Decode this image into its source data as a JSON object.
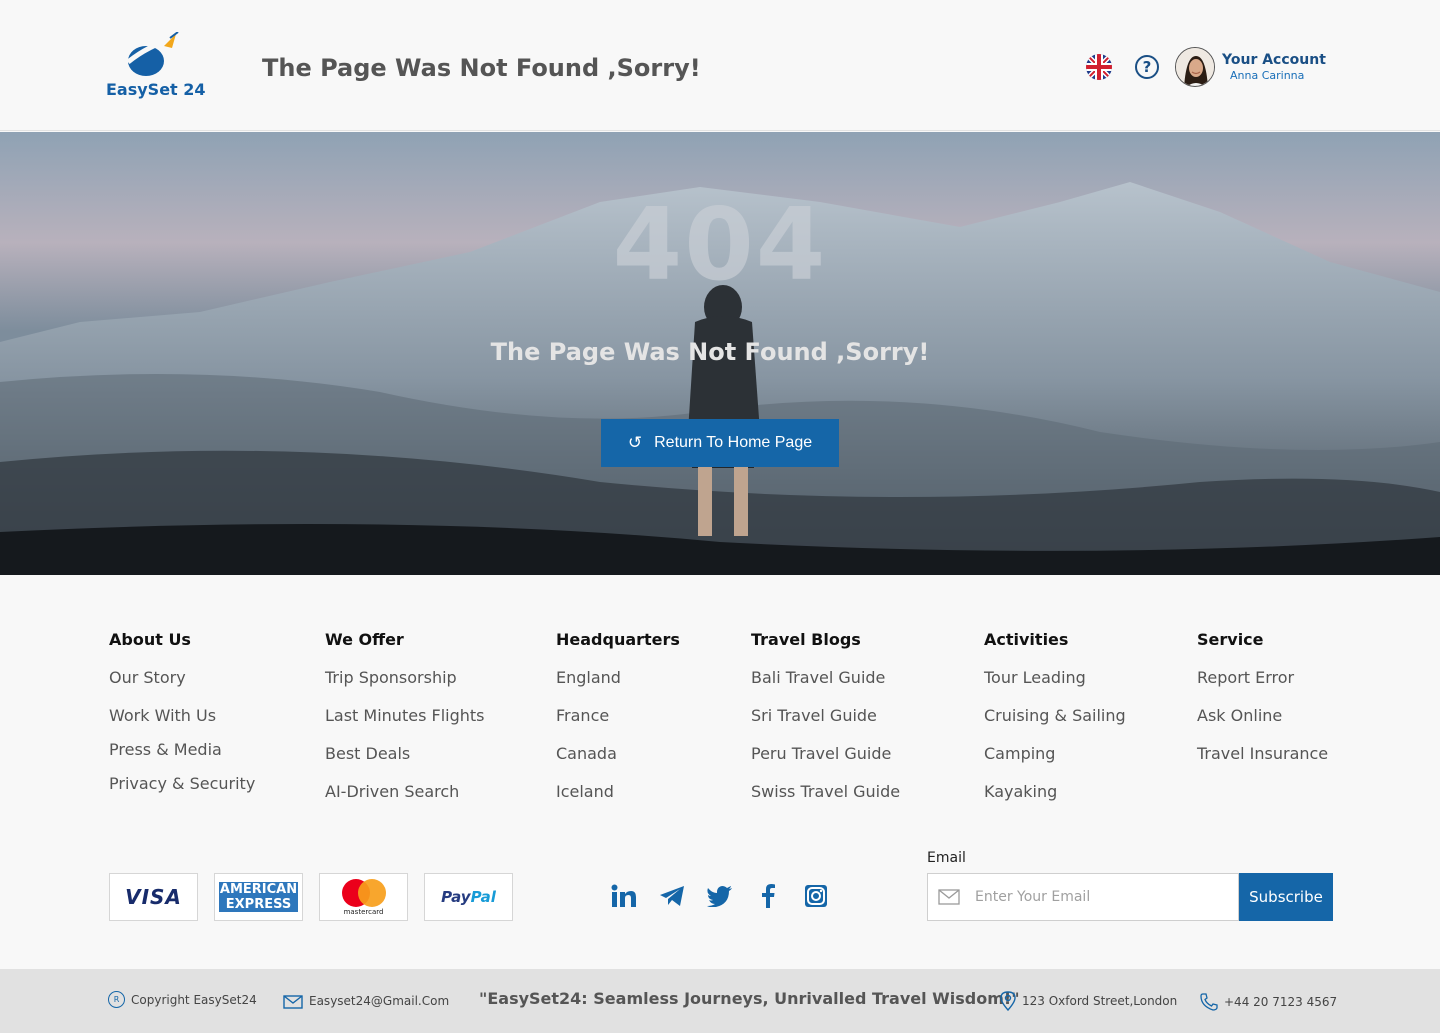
{
  "header": {
    "logo_text": "EasySet 24",
    "title": "The Page Was Not Found ,Sorry!",
    "account_label": "Your Account",
    "account_name": "Anna Carinna"
  },
  "hero": {
    "code": "404",
    "message": "The Page Was Not Found ,Sorry!",
    "button_label": "Return To Home Page"
  },
  "footer": {
    "columns": [
      {
        "title": "About Us",
        "items": [
          "Our Story",
          "Work With Us",
          "Press & Media",
          "Privacy & Security"
        ]
      },
      {
        "title": "We Offer",
        "items": [
          "Trip Sponsorship",
          "Last Minutes Flights",
          "Best Deals",
          "AI-Driven Search"
        ]
      },
      {
        "title": "Headquarters",
        "items": [
          "England",
          "France",
          "Canada",
          "Iceland"
        ]
      },
      {
        "title": "Travel Blogs",
        "items": [
          "Bali Travel Guide",
          "Sri Travel Guide",
          "Peru Travel Guide",
          "Swiss Travel Guide"
        ]
      },
      {
        "title": "Activities",
        "items": [
          "Tour Leading",
          "Cruising & Sailing",
          "Camping",
          "Kayaking"
        ]
      },
      {
        "title": "Service",
        "items": [
          "Report Error",
          "Ask Online",
          "Travel Insurance"
        ]
      }
    ],
    "payments": {
      "visa": "VISA",
      "amex_line1": "AMERICAN",
      "amex_line2": "EXPRESS",
      "mastercard": "mastercard",
      "paypal_a": "Pay",
      "paypal_b": "Pal"
    },
    "social_icons": [
      "linkedin-icon",
      "telegram-icon",
      "twitter-icon",
      "facebook-icon",
      "instagram-icon"
    ],
    "email_label": "Email",
    "email_placeholder": "Enter Your Email",
    "subscribe_label": "Subscribe"
  },
  "bottom_bar": {
    "copyright": "Copyright EasySet24",
    "email": "Easyset24@Gmail.Com",
    "tagline": "\"EasySet24: Seamless Journeys, Unrivalled Travel Wisdom!\"",
    "address": "123 Oxford Street,London",
    "phone": "+44 20 7123 4567"
  },
  "colors": {
    "brand_blue": "#1566a8",
    "dark_blue": "#1a4f85",
    "bottom_bar": "#e1e1e1"
  }
}
